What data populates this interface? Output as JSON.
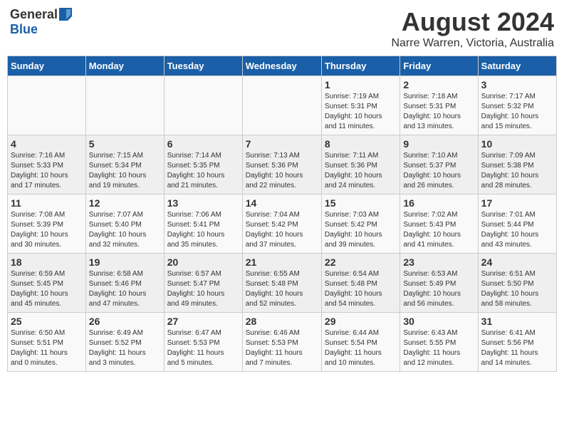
{
  "header": {
    "logo_general": "General",
    "logo_blue": "Blue",
    "title": "August 2024",
    "subtitle": "Narre Warren, Victoria, Australia"
  },
  "columns": [
    "Sunday",
    "Monday",
    "Tuesday",
    "Wednesday",
    "Thursday",
    "Friday",
    "Saturday"
  ],
  "weeks": [
    [
      {
        "day": "",
        "info": ""
      },
      {
        "day": "",
        "info": ""
      },
      {
        "day": "",
        "info": ""
      },
      {
        "day": "",
        "info": ""
      },
      {
        "day": "1",
        "info": "Sunrise: 7:19 AM\nSunset: 5:31 PM\nDaylight: 10 hours\nand 11 minutes."
      },
      {
        "day": "2",
        "info": "Sunrise: 7:18 AM\nSunset: 5:31 PM\nDaylight: 10 hours\nand 13 minutes."
      },
      {
        "day": "3",
        "info": "Sunrise: 7:17 AM\nSunset: 5:32 PM\nDaylight: 10 hours\nand 15 minutes."
      }
    ],
    [
      {
        "day": "4",
        "info": "Sunrise: 7:16 AM\nSunset: 5:33 PM\nDaylight: 10 hours\nand 17 minutes."
      },
      {
        "day": "5",
        "info": "Sunrise: 7:15 AM\nSunset: 5:34 PM\nDaylight: 10 hours\nand 19 minutes."
      },
      {
        "day": "6",
        "info": "Sunrise: 7:14 AM\nSunset: 5:35 PM\nDaylight: 10 hours\nand 21 minutes."
      },
      {
        "day": "7",
        "info": "Sunrise: 7:13 AM\nSunset: 5:36 PM\nDaylight: 10 hours\nand 22 minutes."
      },
      {
        "day": "8",
        "info": "Sunrise: 7:11 AM\nSunset: 5:36 PM\nDaylight: 10 hours\nand 24 minutes."
      },
      {
        "day": "9",
        "info": "Sunrise: 7:10 AM\nSunset: 5:37 PM\nDaylight: 10 hours\nand 26 minutes."
      },
      {
        "day": "10",
        "info": "Sunrise: 7:09 AM\nSunset: 5:38 PM\nDaylight: 10 hours\nand 28 minutes."
      }
    ],
    [
      {
        "day": "11",
        "info": "Sunrise: 7:08 AM\nSunset: 5:39 PM\nDaylight: 10 hours\nand 30 minutes."
      },
      {
        "day": "12",
        "info": "Sunrise: 7:07 AM\nSunset: 5:40 PM\nDaylight: 10 hours\nand 32 minutes."
      },
      {
        "day": "13",
        "info": "Sunrise: 7:06 AM\nSunset: 5:41 PM\nDaylight: 10 hours\nand 35 minutes."
      },
      {
        "day": "14",
        "info": "Sunrise: 7:04 AM\nSunset: 5:42 PM\nDaylight: 10 hours\nand 37 minutes."
      },
      {
        "day": "15",
        "info": "Sunrise: 7:03 AM\nSunset: 5:42 PM\nDaylight: 10 hours\nand 39 minutes."
      },
      {
        "day": "16",
        "info": "Sunrise: 7:02 AM\nSunset: 5:43 PM\nDaylight: 10 hours\nand 41 minutes."
      },
      {
        "day": "17",
        "info": "Sunrise: 7:01 AM\nSunset: 5:44 PM\nDaylight: 10 hours\nand 43 minutes."
      }
    ],
    [
      {
        "day": "18",
        "info": "Sunrise: 6:59 AM\nSunset: 5:45 PM\nDaylight: 10 hours\nand 45 minutes."
      },
      {
        "day": "19",
        "info": "Sunrise: 6:58 AM\nSunset: 5:46 PM\nDaylight: 10 hours\nand 47 minutes."
      },
      {
        "day": "20",
        "info": "Sunrise: 6:57 AM\nSunset: 5:47 PM\nDaylight: 10 hours\nand 49 minutes."
      },
      {
        "day": "21",
        "info": "Sunrise: 6:55 AM\nSunset: 5:48 PM\nDaylight: 10 hours\nand 52 minutes."
      },
      {
        "day": "22",
        "info": "Sunrise: 6:54 AM\nSunset: 5:48 PM\nDaylight: 10 hours\nand 54 minutes."
      },
      {
        "day": "23",
        "info": "Sunrise: 6:53 AM\nSunset: 5:49 PM\nDaylight: 10 hours\nand 56 minutes."
      },
      {
        "day": "24",
        "info": "Sunrise: 6:51 AM\nSunset: 5:50 PM\nDaylight: 10 hours\nand 58 minutes."
      }
    ],
    [
      {
        "day": "25",
        "info": "Sunrise: 6:50 AM\nSunset: 5:51 PM\nDaylight: 11 hours\nand 0 minutes."
      },
      {
        "day": "26",
        "info": "Sunrise: 6:49 AM\nSunset: 5:52 PM\nDaylight: 11 hours\nand 3 minutes."
      },
      {
        "day": "27",
        "info": "Sunrise: 6:47 AM\nSunset: 5:53 PM\nDaylight: 11 hours\nand 5 minutes."
      },
      {
        "day": "28",
        "info": "Sunrise: 6:46 AM\nSunset: 5:53 PM\nDaylight: 11 hours\nand 7 minutes."
      },
      {
        "day": "29",
        "info": "Sunrise: 6:44 AM\nSunset: 5:54 PM\nDaylight: 11 hours\nand 10 minutes."
      },
      {
        "day": "30",
        "info": "Sunrise: 6:43 AM\nSunset: 5:55 PM\nDaylight: 11 hours\nand 12 minutes."
      },
      {
        "day": "31",
        "info": "Sunrise: 6:41 AM\nSunset: 5:56 PM\nDaylight: 11 hours\nand 14 minutes."
      }
    ]
  ]
}
